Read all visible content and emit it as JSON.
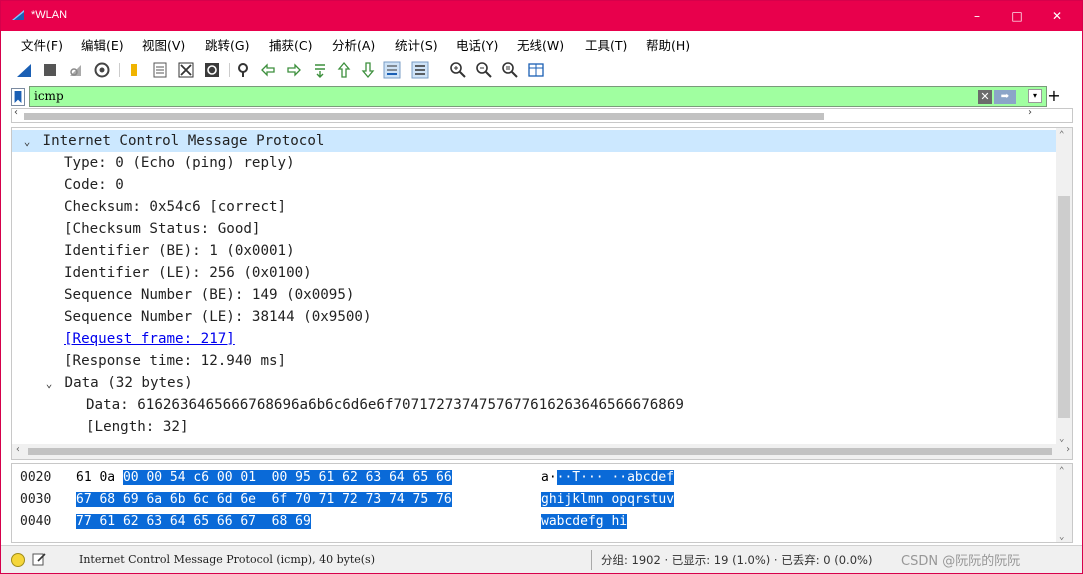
{
  "window": {
    "title": "*WLAN",
    "controls": {
      "minimize": "–",
      "maximize": "□",
      "close": "✕"
    }
  },
  "menu": [
    "文件(F)",
    "编辑(E)",
    "视图(V)",
    "跳转(G)",
    "捕获(C)",
    "分析(A)",
    "统计(S)",
    "电话(Y)",
    "无线(W)",
    "工具(T)",
    "帮助(H)"
  ],
  "filter": {
    "value": "icmp",
    "clear_label": "✕",
    "apply_label": "➡",
    "dropdown_label": "▾",
    "add_label": "+"
  },
  "details": {
    "rows": [
      {
        "text": "Internet Control Message Protocol",
        "tw": "⌄",
        "indent": 0,
        "selected": true
      },
      {
        "text": "Type: 0 (Echo (ping) reply)",
        "indent": 1
      },
      {
        "text": "Code: 0",
        "indent": 1
      },
      {
        "text": "Checksum: 0x54c6 [correct]",
        "indent": 1
      },
      {
        "text": "[Checksum Status: Good]",
        "indent": 1
      },
      {
        "text": "Identifier (BE): 1 (0x0001)",
        "indent": 1
      },
      {
        "text": "Identifier (LE): 256 (0x0100)",
        "indent": 1
      },
      {
        "text": "Sequence Number (BE): 149 (0x0095)",
        "indent": 1
      },
      {
        "text": "Sequence Number (LE): 38144 (0x9500)",
        "indent": 1
      },
      {
        "text": "[Request frame: 217]",
        "indent": 1,
        "link": true
      },
      {
        "text": "[Response time: 12.940 ms]",
        "indent": 1
      },
      {
        "text": "Data (32 bytes)",
        "tw": "⌄",
        "indent": 1,
        "subtree": true
      },
      {
        "text": "Data: 6162636465666768696a6b6c6d6e6f7071727374757677616263646566676869",
        "indent": 2
      },
      {
        "text": "[Length: 32]",
        "indent": 2
      }
    ]
  },
  "bytes": [
    {
      "offset": "0020",
      "hex_plain": "61 0a ",
      "hex_hl": "00 00 54 c6 00 01  00 95 61 62 63 64 65 66",
      "asc_plain": "a·",
      "asc_hl": "··T··· ··abcdef"
    },
    {
      "offset": "0030",
      "hex_plain": "",
      "hex_hl": "67 68 69 6a 6b 6c 6d 6e  6f 70 71 72 73 74 75 76",
      "asc_plain": "",
      "asc_hl": "ghijklmn opqrstuv"
    },
    {
      "offset": "0040",
      "hex_plain": "",
      "hex_hl": "77 61 62 63 64 65 66 67  68 69",
      "asc_plain": "",
      "asc_hl": "wabcdefg hi"
    }
  ],
  "status": {
    "message": "Internet Control Message Protocol (icmp), 40 byte(s)",
    "stats": "分组: 1902 · 已显示: 19 (1.0%) · 已丢弃: 0 (0.0%)",
    "watermark": "CSDN @阮阮的阮阮"
  },
  "colors": {
    "titlebar": "#e8004c",
    "filter_ok": "#a0ffa0",
    "byte_highlight": "#0a6ad8",
    "selected_row": "#cce8ff",
    "link": "#0000ee"
  }
}
